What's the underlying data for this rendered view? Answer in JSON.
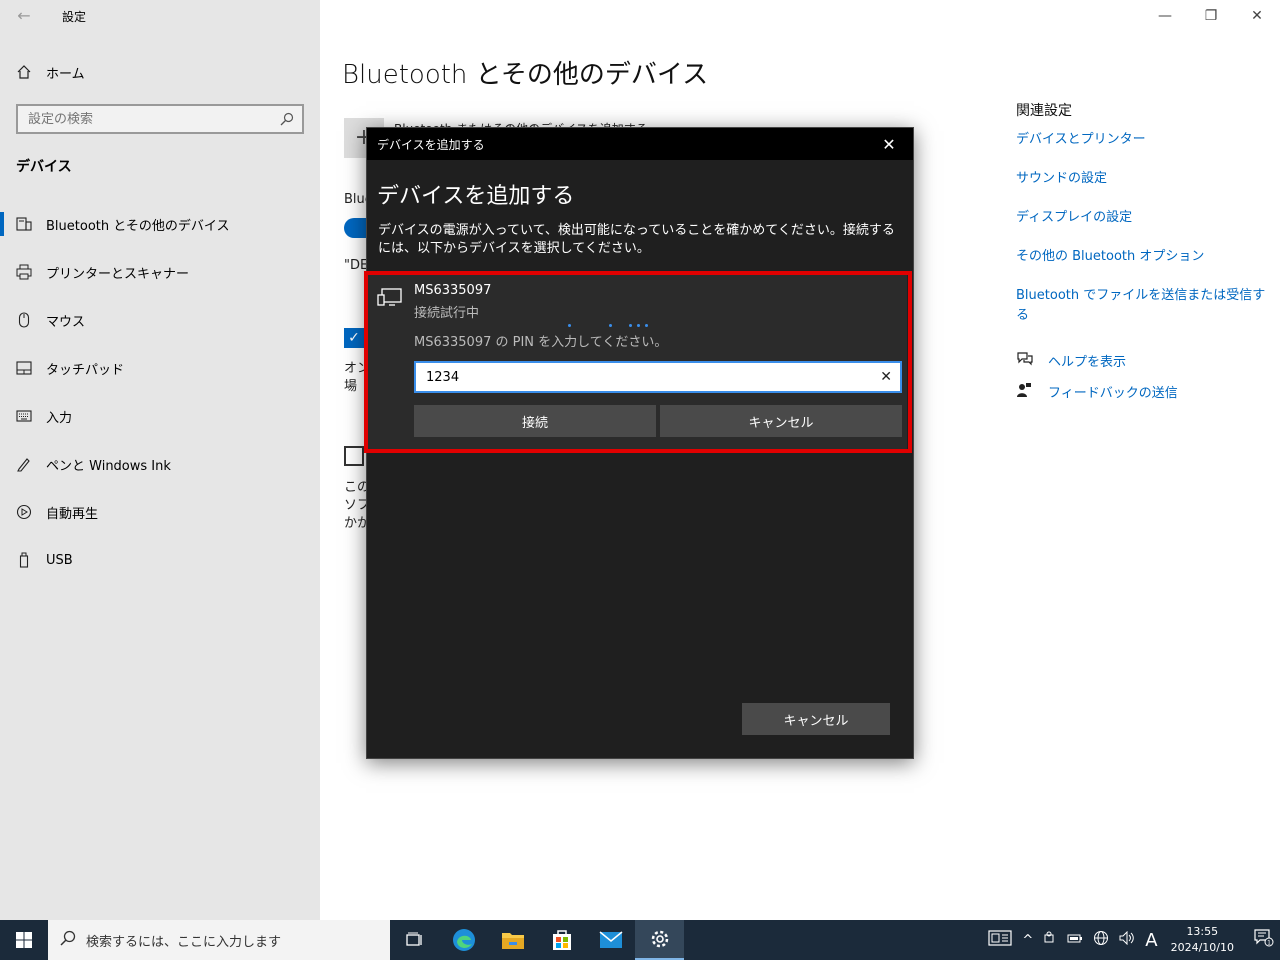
{
  "window": {
    "app_title": "設定",
    "back": "←",
    "minimize": "—",
    "restore": "❐",
    "close": "✕"
  },
  "sidebar": {
    "home_label": "ホーム",
    "search_placeholder": "設定の検索",
    "section_title": "デバイス",
    "items": [
      {
        "label": "Bluetooth とその他のデバイス",
        "icon": "bluetooth-devices-icon",
        "active": true
      },
      {
        "label": "プリンターとスキャナー",
        "icon": "printer-icon"
      },
      {
        "label": "マウス",
        "icon": "mouse-icon"
      },
      {
        "label": "タッチパッド",
        "icon": "touchpad-icon"
      },
      {
        "label": "入力",
        "icon": "keyboard-icon"
      },
      {
        "label": "ペンと Windows Ink",
        "icon": "pen-icon"
      },
      {
        "label": "自動再生",
        "icon": "autoplay-icon"
      },
      {
        "label": "USB",
        "icon": "usb-icon"
      }
    ]
  },
  "main": {
    "page_title": "Bluetooth とその他のデバイス",
    "add_text_partial": "Bluetooth またはその他のデバイスを追加する",
    "bluetooth_partial": "Blue",
    "de_partial": "\"DE",
    "on_partial_1": "オン",
    "on_partial_2": "場",
    "this_partial_1": "この",
    "this_partial_2": "ソフ",
    "this_partial_3": "かか"
  },
  "related": {
    "title": "関連設定",
    "links": [
      "デバイスとプリンター",
      "サウンドの設定",
      "ディスプレイの設定",
      "その他の Bluetooth オプション",
      "Bluetooth でファイルを送信または受信する"
    ],
    "help": "ヘルプを表示",
    "feedback": "フィードバックの送信"
  },
  "dialog": {
    "title_bar": "デバイスを追加する",
    "heading": "デバイスを追加する",
    "description": "デバイスの電源が入っていて、検出可能になっていることを確かめてください。接続するには、以下からデバイスを選択してください。",
    "device_name": "MS6335097",
    "device_status": "接続試行中",
    "pin_prompt": "MS6335097 の PIN を入力してください。",
    "pin_value": "1234",
    "connect_label": "接続",
    "cancel_pin_label": "キャンセル",
    "cancel_label": "キャンセル"
  },
  "taskbar": {
    "search_placeholder": "検索するには、ここに入力します",
    "ime": "A",
    "time": "13:55",
    "date": "2024/10/10",
    "notification_count": "1"
  },
  "colors": {
    "accent": "#0067c0",
    "highlight": "#e00000",
    "dialog_bg": "#1f1f1f",
    "taskbar": "#1b2a3a"
  }
}
